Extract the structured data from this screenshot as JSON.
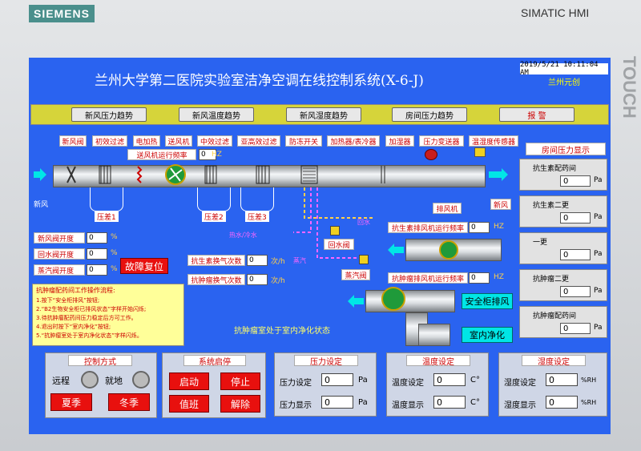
{
  "brand": {
    "logo": "SIEMENS",
    "device": "SIMATIC HMI",
    "side_text": "TOUCH"
  },
  "screen": {
    "title": "兰州大学第二医院实验室洁净空调在线控制系统(X-6-J)",
    "clock": "2019/5/21 10:11:04 AM",
    "company": "兰州元创",
    "trend_buttons": [
      "新风压力趋势",
      "新风温度趋势",
      "新风湿度趋势",
      "房间压力趋势"
    ],
    "alarm_button": "报    警",
    "component_tags": [
      "新风阀",
      "初效过滤",
      "电加热",
      "送风机",
      "中效过滤",
      "亚高效过滤",
      "防冻开关",
      "加热器/表冷器",
      "加湿器",
      "压力变送器",
      "温湿度传感器"
    ],
    "supply_fan_freq": {
      "label": "送风机运行频率",
      "value": "0",
      "unit": "HZ"
    },
    "fresh_air_left": "新风",
    "fresh_air_right": "新风",
    "exhaust_fan": "排风机",
    "room_pressure_title": "房间压力显示",
    "diff_pressure": [
      "压差1",
      "压差2",
      "压差3"
    ],
    "valves": {
      "fresh_air_valve": {
        "label": "新风阀开度",
        "value": "0",
        "unit": "%"
      },
      "return_valve": {
        "label": "回水阀开度",
        "value": "0",
        "unit": "%"
      },
      "steam_valve": {
        "label": "蒸汽阀开度",
        "value": "0",
        "unit": "%"
      }
    },
    "fault_reset": "故障复位",
    "return_valve_label": "回水阀",
    "steam_valve_label": "蒸汽阀",
    "dashed_labels": [
      "热水/冷水",
      "回水",
      "蒸汽"
    ],
    "air_changes": {
      "antibiotic": {
        "label": "抗生素换气次数",
        "value": "0",
        "unit": "次/h"
      },
      "antitumor": {
        "label": "抗肿瘤换气次数",
        "value": "0",
        "unit": "次/h"
      }
    },
    "exhaust_freq": {
      "antibiotic": {
        "label": "抗生素排风机运行频率",
        "value": "0",
        "unit": "HZ"
      },
      "antitumor": {
        "label": "抗肿瘤排风机运行频率",
        "value": "0",
        "unit": "HZ"
      }
    },
    "procedure": {
      "title": "抗肿瘤配药间工作操作流程:",
      "steps": [
        "1.按下“安全柜排风”按钮;",
        "2.“B2生物安全柜已排风状态”字样开始闪烁;",
        "3.待抗肿瘤配药间压力稳定后方可工作。",
        "4.退出时按下“室内净化”按钮;",
        "5.“抗肿瘤室处于室内净化状态”字样闪烁。"
      ]
    },
    "status_text": "抗肿瘤室处于室内净化状态",
    "cabinet_exhaust_button": "安全柜排风",
    "room_purify_button": "室内净化",
    "rooms": [
      {
        "name": "抗生素配药间",
        "value": "0",
        "unit": "Pa"
      },
      {
        "name": "抗生素二更",
        "value": "0",
        "unit": "Pa"
      },
      {
        "name": "一更",
        "value": "0",
        "unit": "Pa"
      },
      {
        "name": "抗肿瘤二更",
        "value": "0",
        "unit": "Pa"
      },
      {
        "name": "抗肿瘤配药间",
        "value": "0",
        "unit": "Pa"
      }
    ],
    "control_mode": {
      "title": "控制方式",
      "remote": "远程",
      "local": "就地",
      "summer": "夏季",
      "winter": "冬季"
    },
    "system": {
      "title": "系统启停",
      "start": "启动",
      "stop": "停止",
      "duty": "值班",
      "release": "解除"
    },
    "pressure_set": {
      "title": "压力设定",
      "set_label": "压力设定",
      "set_value": "0",
      "display_label": "压力显示",
      "display_value": "0",
      "unit": "Pa"
    },
    "temp_set": {
      "title": "温度设定",
      "set_label": "温度设定",
      "set_value": "0",
      "display_label": "温度显示",
      "display_value": "0",
      "unit": "C°"
    },
    "humidity_set": {
      "title": "湿度设定",
      "set_label": "湿度设定",
      "set_value": "0",
      "display_label": "湿度显示",
      "display_value": "0",
      "unit": "%RH"
    }
  }
}
